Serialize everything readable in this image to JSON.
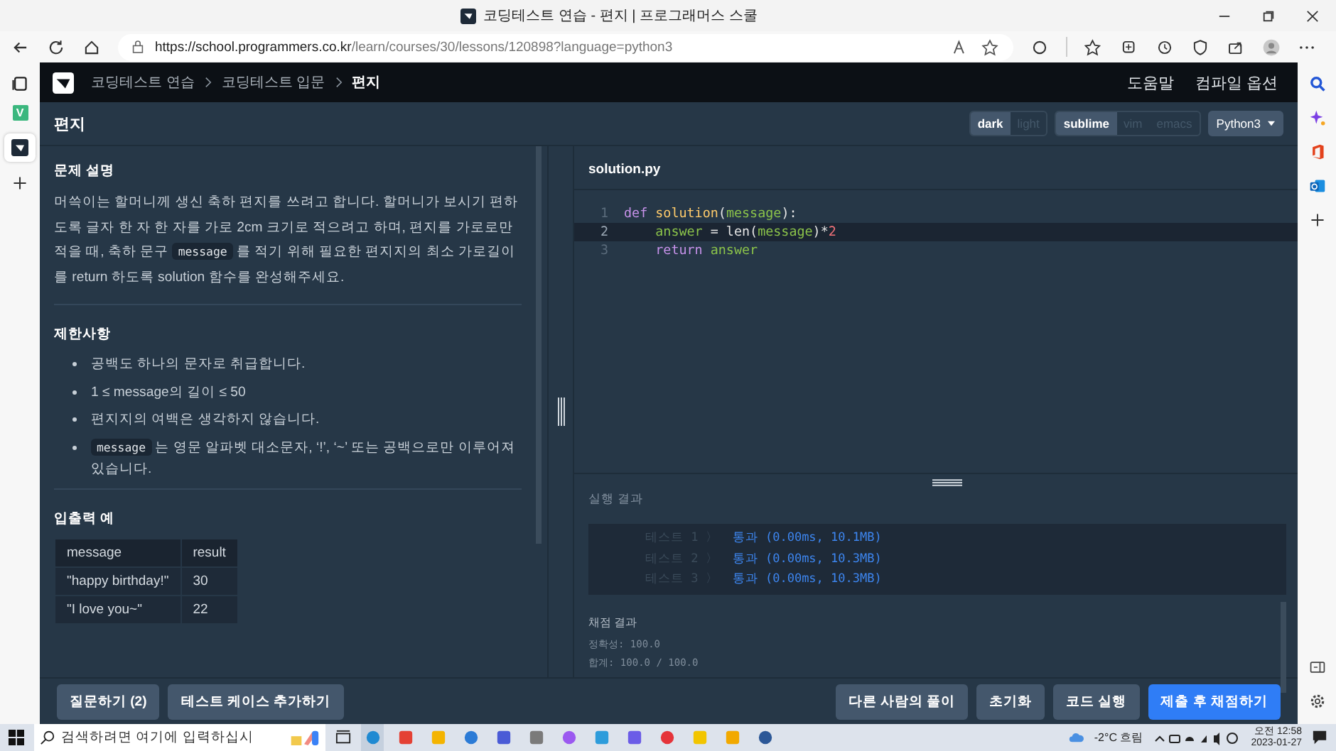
{
  "browser": {
    "title": "코딩테스트 연습 - 편지 | 프로그래머스 스쿨",
    "url_host": "https://school.programmers.co.kr",
    "url_path": "/learn/courses/30/lessons/120898?language=python3",
    "sidebar_badge": "V"
  },
  "nav": {
    "breadcrumbs": [
      {
        "label": "코딩테스트 연습",
        "current": false
      },
      {
        "label": "코딩테스트 입문",
        "current": false
      },
      {
        "label": "편지",
        "current": true
      }
    ],
    "links": [
      "도움말",
      "컴파일 옵션"
    ]
  },
  "header": {
    "title": "편지",
    "themes": [
      {
        "label": "dark",
        "selected": true
      },
      {
        "label": "light",
        "selected": false
      }
    ],
    "keymaps": [
      {
        "label": "sublime",
        "selected": true
      },
      {
        "label": "vim",
        "selected": false
      },
      {
        "label": "emacs",
        "selected": false
      }
    ],
    "language": "Python3"
  },
  "problem": {
    "description_heading": "문제 설명",
    "description": [
      {
        "text": "머쓱이는 할머니께 생신 축하 편지를 쓰려고 합니다. 할머니가 보시기 편하도록 글자 한 자 한 자를 가로 2cm 크기로 적으려고 하며, 편지를 가로로만 적을 때, 축하 문구 ",
        "code": false
      },
      {
        "text": "message",
        "code": true
      },
      {
        "text": " 를 적기 위해 필요한 편지지의 최소 가로길이를 return 하도록 solution 함수를 완성해주세요.",
        "code": false
      }
    ],
    "constraints_heading": "제한사항",
    "constraints": [
      [
        {
          "text": "공백도 하나의 문자로 취급합니다.",
          "code": false
        }
      ],
      [
        {
          "text": "1 ≤ message의 길이 ≤ 50",
          "code": false
        }
      ],
      [
        {
          "text": "편지지의 여백은 생각하지 않습니다.",
          "code": false
        }
      ],
      [
        {
          "text": "message",
          "code": true
        },
        {
          "text": " 는 영문 알파벳 대소문자, ‘!’, ‘~’ 또는 공백으로만 이루어져 있습니다.",
          "code": false
        }
      ]
    ],
    "examples_heading": "입출력 예",
    "examples": {
      "columns": [
        "message",
        "result"
      ],
      "rows": [
        [
          "\"happy birthday!\"",
          "30"
        ],
        [
          "\"I love you~\"",
          "22"
        ]
      ]
    }
  },
  "editor": {
    "filename": "solution.py",
    "lines": [
      {
        "number": "1",
        "active": false,
        "tokens": [
          {
            "text": "def",
            "kind": "keyword"
          },
          {
            "text": " solution",
            "kind": "function"
          },
          {
            "text": "(",
            "kind": "plain"
          },
          {
            "text": "message",
            "kind": "variable"
          },
          {
            "text": "):",
            "kind": "plain"
          }
        ]
      },
      {
        "number": "2",
        "active": true,
        "tokens": [
          {
            "text": "    answer",
            "kind": "variable"
          },
          {
            "text": " = len(",
            "kind": "plain"
          },
          {
            "text": "message",
            "kind": "variable"
          },
          {
            "text": ")*",
            "kind": "plain"
          },
          {
            "text": "2",
            "kind": "number"
          }
        ]
      },
      {
        "number": "3",
        "active": false,
        "tokens": [
          {
            "text": "    return",
            "kind": "keyword"
          },
          {
            "text": " answer",
            "kind": "variable"
          }
        ]
      }
    ]
  },
  "results": {
    "title": "실행 결과",
    "tests": [
      {
        "label": "테스트 1 〉",
        "result": "통과 (0.00ms, 10.1MB)"
      },
      {
        "label": "테스트 2 〉",
        "result": "통과 (0.00ms, 10.3MB)"
      },
      {
        "label": "테스트 3 〉",
        "result": "통과 (0.00ms, 10.3MB)"
      }
    ],
    "score_title": "채점 결과",
    "scores": [
      "정확성: 100.0",
      "합계: 100.0 / 100.0"
    ]
  },
  "footer": {
    "left_buttons": [
      {
        "label": "질문하기 (2)",
        "kind": "secondary"
      },
      {
        "label": "테스트 케이스 추가하기",
        "kind": "secondary"
      }
    ],
    "right_buttons": [
      {
        "label": "다른 사람의 풀이",
        "kind": "secondary"
      },
      {
        "label": "초기화",
        "kind": "secondary"
      },
      {
        "label": "코드 실행",
        "kind": "secondary"
      },
      {
        "label": "제출 후 채점하기",
        "kind": "primary"
      }
    ]
  },
  "taskbar": {
    "search_placeholder": "검색하려면 여기에 입력하십시",
    "weather": "-2°C 흐림",
    "time": "오전 12:58",
    "date": "2023-01-27"
  }
}
